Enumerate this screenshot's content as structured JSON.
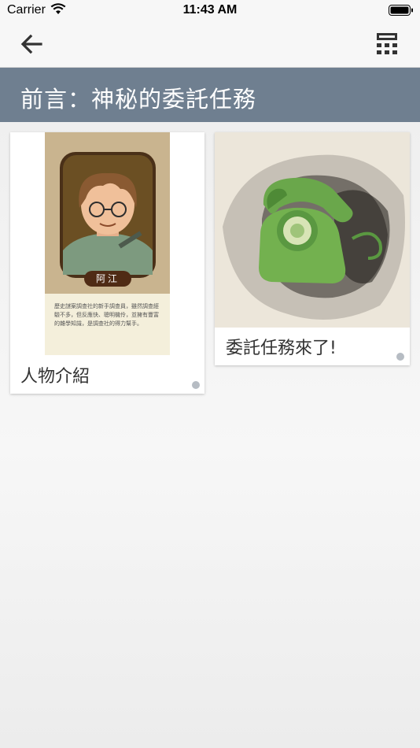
{
  "status_bar": {
    "carrier": "Carrier",
    "time": "11:43 AM"
  },
  "nav": {
    "back_icon": "arrow-left-icon",
    "menu_icon": "grid-menu-icon"
  },
  "header": {
    "title": "前言：神秘的委託任務"
  },
  "cards": [
    {
      "label": "人物介紹",
      "image": {
        "name_tag": "阿江",
        "description": "歷史謎案調查社的新手調查員，雖然調查經驗不多，但反應快、聰明機伶，並擁有豐富的雜學知識，是調查社的得力幫手。"
      }
    },
    {
      "label": "委託任務來了!",
      "image_icon": "rotary-phone-icon"
    }
  ],
  "colors": {
    "header_bg": "#6f7f90",
    "dot": "#b6bcc3"
  }
}
